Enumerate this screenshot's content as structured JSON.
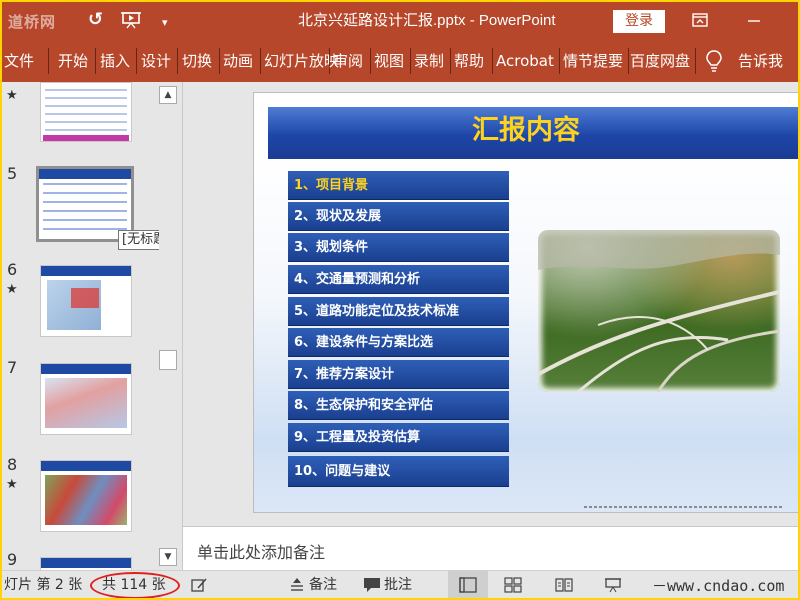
{
  "titlebar": {
    "watermark": "道桥网",
    "doc_title": "北京兴延路设计汇报.pptx - PowerPoint",
    "login_label": "登录"
  },
  "ribbon": {
    "tabs": [
      "文件",
      "开始",
      "插入",
      "设计",
      "切换",
      "动画",
      "幻灯片放映",
      "审阅",
      "视图",
      "录制",
      "帮助",
      "Acrobat",
      "情节提要",
      "百度网盘",
      "告诉我"
    ]
  },
  "thumbnails": {
    "slides": [
      {
        "number": "5",
        "star": ""
      },
      {
        "number": "6",
        "star": "★"
      },
      {
        "number": "7",
        "star": ""
      },
      {
        "number": "8",
        "star": "★"
      },
      {
        "number": "9",
        "star": ""
      }
    ],
    "top_star": "★",
    "tooltip": "[无标题]"
  },
  "slide": {
    "title": "汇报内容",
    "items": [
      "1、项目背景",
      "2、现状及发展",
      "3、规划条件",
      "4、交通量预测和分析",
      "5、道路功能定位及技术标准",
      "6、建设条件与方案比选",
      "7、推荐方案设计",
      "8、生态保护和安全评估",
      "9、工程量及投资估算",
      "10、问题与建议"
    ],
    "active_index": 0
  },
  "notes": {
    "placeholder": "单击此处添加备注"
  },
  "status": {
    "slide_info": "灯片 第 2 张",
    "total": "共 114 张",
    "notes_label": "备注",
    "comments_label": "批注",
    "zoom_watermark": "－www.cndao.com"
  },
  "colors": {
    "accent": "#b7472a",
    "slide_blue": "#1e46a8",
    "slide_title_yellow": "#ffd21c",
    "highlight_red": "#e0201b"
  }
}
